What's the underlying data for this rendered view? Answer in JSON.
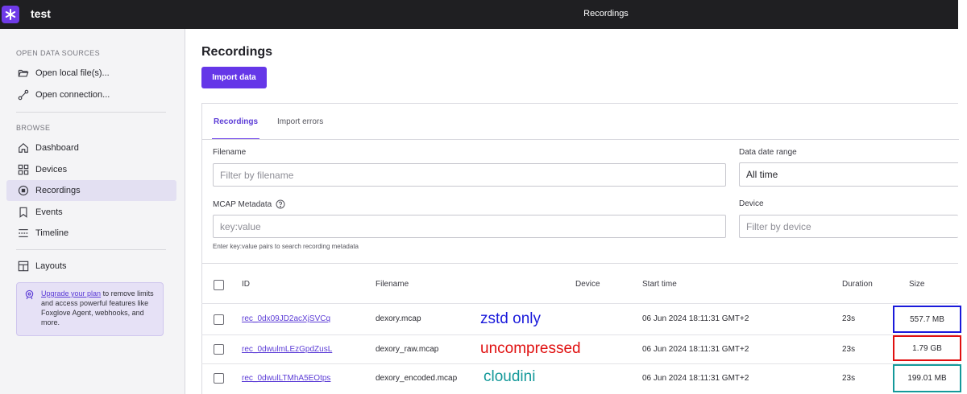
{
  "topbar": {
    "workspace": "test",
    "title": "Recordings",
    "logo_icon": "asterisk-logo-icon",
    "logo_color": "#6f3be8"
  },
  "sidebar": {
    "open_section": "OPEN DATA SOURCES",
    "open_items": [
      {
        "label": "Open local file(s)...",
        "icon": "folder-open-icon"
      },
      {
        "label": "Open connection...",
        "icon": "connection-icon"
      }
    ],
    "browse_section": "BROWSE",
    "browse_items": [
      {
        "label": "Dashboard",
        "icon": "home-icon",
        "active": false
      },
      {
        "label": "Devices",
        "icon": "grid-icon",
        "active": false
      },
      {
        "label": "Recordings",
        "icon": "record-icon",
        "active": true
      },
      {
        "label": "Events",
        "icon": "bookmark-icon",
        "active": false
      },
      {
        "label": "Timeline",
        "icon": "timeline-icon",
        "active": false
      }
    ],
    "layouts_item": {
      "label": "Layouts",
      "icon": "layout-icon"
    },
    "upgrade": {
      "link": "Upgrade your plan",
      "text": " to remove limits and access powerful features like Foxglove Agent, webhooks, and more."
    }
  },
  "main": {
    "title": "Recordings",
    "import_button": "Import data",
    "accent_color": "#6537e8",
    "tabs": [
      {
        "label": "Recordings",
        "active": true
      },
      {
        "label": "Import errors",
        "active": false
      }
    ],
    "filters": {
      "filename_label": "Filename",
      "filename_placeholder": "Filter by filename",
      "date_label": "Data date range",
      "date_value": "All time",
      "metadata_label": "MCAP Metadata",
      "metadata_placeholder": "key:value",
      "metadata_help": "Enter key:value pairs to search recording metadata",
      "device_label": "Device",
      "device_placeholder": "Filter by device"
    },
    "table": {
      "headers": {
        "id": "ID",
        "filename": "Filename",
        "device": "Device",
        "start": "Start time",
        "duration": "Duration",
        "size": "Size"
      },
      "rows": [
        {
          "id": "rec_0dx09JD2acXjSVCq",
          "filename": "dexory.mcap",
          "device": "",
          "start": "06 Jun 2024 18:11:31 GMT+2",
          "duration": "23s",
          "size": "557.7 MB",
          "note": "zstd only",
          "note_color": "#1a1adb",
          "box_color": "#1a1adb"
        },
        {
          "id": "rec_0dwulmLEzGpdZusL",
          "filename": "dexory_raw.mcap",
          "device": "",
          "start": "06 Jun 2024 18:11:31 GMT+2",
          "duration": "23s",
          "size": "1.79 GB",
          "note": "uncompressed",
          "note_color": "#e01010",
          "box_color": "#e01010"
        },
        {
          "id": "rec_0dwulLTMhA5EOtps",
          "filename": "dexory_encoded.mcap",
          "device": "",
          "start": "06 Jun 2024 18:11:31 GMT+2",
          "duration": "23s",
          "size": "199.01 MB",
          "note": "cloudini",
          "note_color": "#14999a",
          "box_color": "#14999a"
        }
      ]
    }
  }
}
